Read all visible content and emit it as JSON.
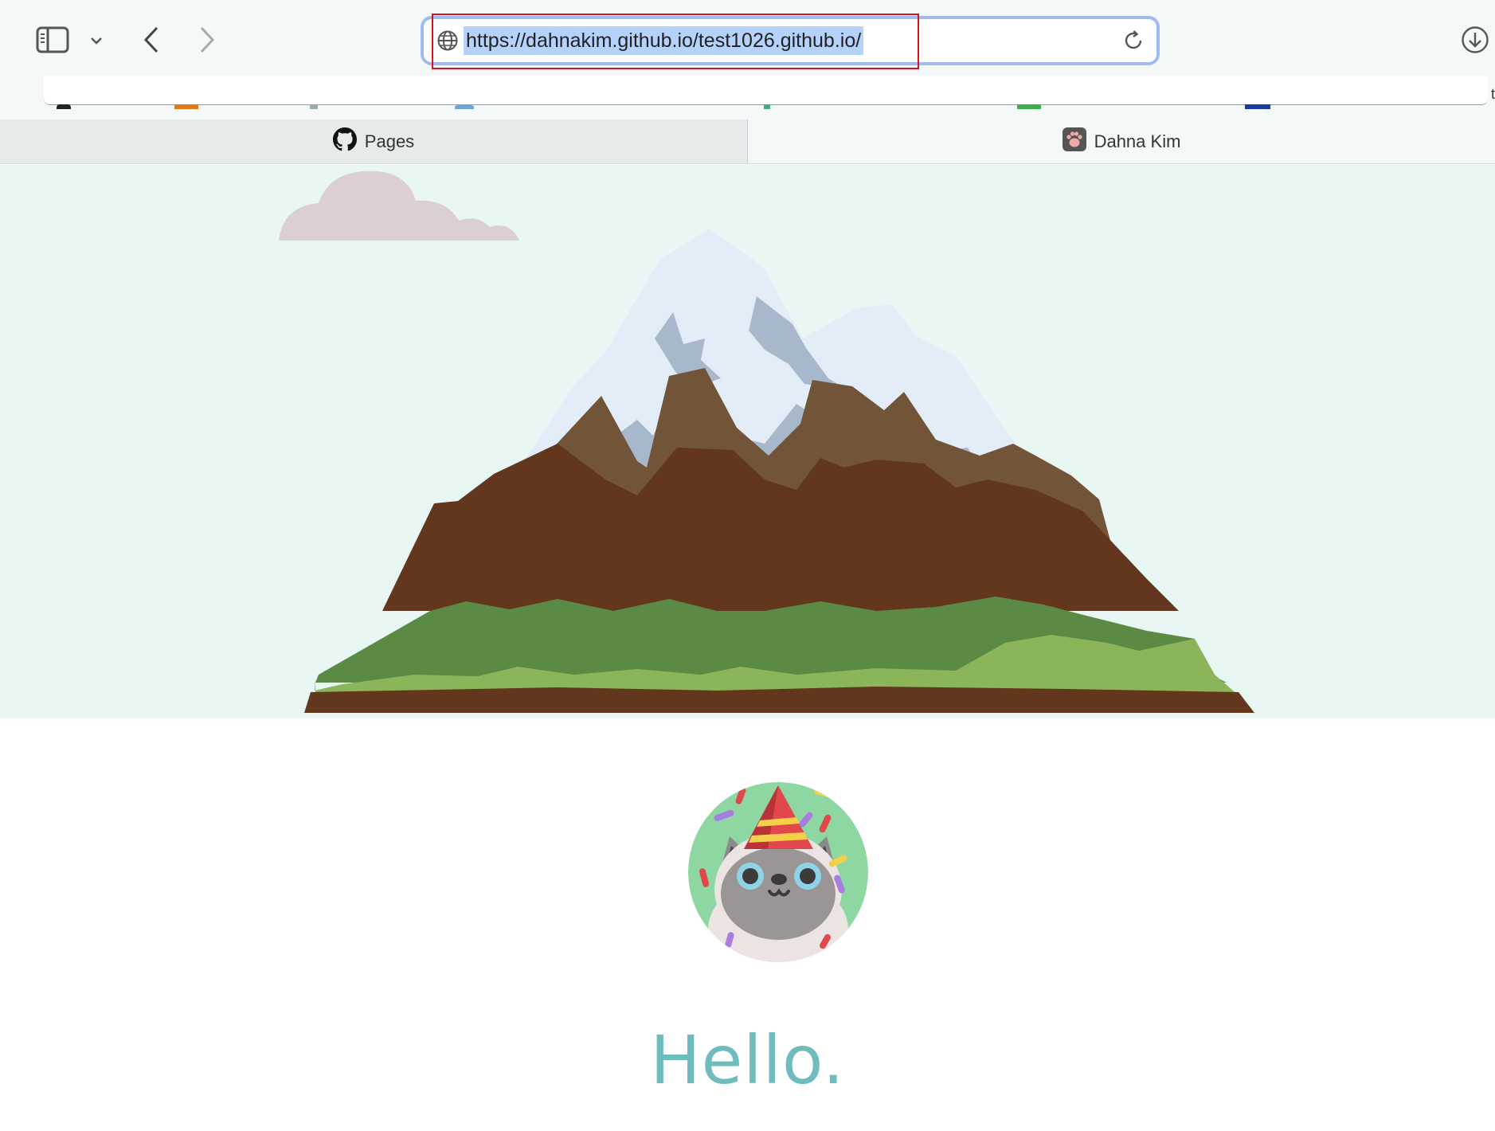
{
  "browser": {
    "url": "https://dahnakim.github.io/test1026.github.io/",
    "icons": {
      "sidebar": "sidebar-icon",
      "dropdown": "chevron-down-icon",
      "back": "chevron-left-icon",
      "forward": "chevron-right-icon",
      "site": "globe-icon",
      "reload": "reload-icon",
      "download": "download-icon"
    },
    "edge_char": "t"
  },
  "tabs": [
    {
      "label": "Pages",
      "icon": "github-icon",
      "active": false
    },
    {
      "label": "Dahna Kim",
      "icon": "paw-icon",
      "active": true
    }
  ],
  "page": {
    "greeting": "Hello.",
    "colors": {
      "hero_bg": "#e8f7f3",
      "greeting": "#6fbcbf",
      "url_selection": "#b4d2fb",
      "highlight": "#d3121b"
    }
  }
}
